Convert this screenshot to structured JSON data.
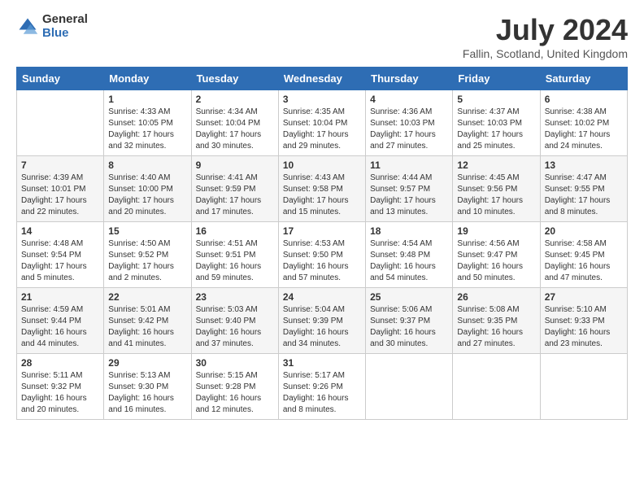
{
  "header": {
    "logo_general": "General",
    "logo_blue": "Blue",
    "month_title": "July 2024",
    "location": "Fallin, Scotland, United Kingdom"
  },
  "days_of_week": [
    "Sunday",
    "Monday",
    "Tuesday",
    "Wednesday",
    "Thursday",
    "Friday",
    "Saturday"
  ],
  "weeks": [
    [
      {
        "day": "",
        "info": ""
      },
      {
        "day": "1",
        "info": "Sunrise: 4:33 AM\nSunset: 10:05 PM\nDaylight: 17 hours and 32 minutes."
      },
      {
        "day": "2",
        "info": "Sunrise: 4:34 AM\nSunset: 10:04 PM\nDaylight: 17 hours and 30 minutes."
      },
      {
        "day": "3",
        "info": "Sunrise: 4:35 AM\nSunset: 10:04 PM\nDaylight: 17 hours and 29 minutes."
      },
      {
        "day": "4",
        "info": "Sunrise: 4:36 AM\nSunset: 10:03 PM\nDaylight: 17 hours and 27 minutes."
      },
      {
        "day": "5",
        "info": "Sunrise: 4:37 AM\nSunset: 10:03 PM\nDaylight: 17 hours and 25 minutes."
      },
      {
        "day": "6",
        "info": "Sunrise: 4:38 AM\nSunset: 10:02 PM\nDaylight: 17 hours and 24 minutes."
      }
    ],
    [
      {
        "day": "7",
        "info": "Sunrise: 4:39 AM\nSunset: 10:01 PM\nDaylight: 17 hours and 22 minutes."
      },
      {
        "day": "8",
        "info": "Sunrise: 4:40 AM\nSunset: 10:00 PM\nDaylight: 17 hours and 20 minutes."
      },
      {
        "day": "9",
        "info": "Sunrise: 4:41 AM\nSunset: 9:59 PM\nDaylight: 17 hours and 17 minutes."
      },
      {
        "day": "10",
        "info": "Sunrise: 4:43 AM\nSunset: 9:58 PM\nDaylight: 17 hours and 15 minutes."
      },
      {
        "day": "11",
        "info": "Sunrise: 4:44 AM\nSunset: 9:57 PM\nDaylight: 17 hours and 13 minutes."
      },
      {
        "day": "12",
        "info": "Sunrise: 4:45 AM\nSunset: 9:56 PM\nDaylight: 17 hours and 10 minutes."
      },
      {
        "day": "13",
        "info": "Sunrise: 4:47 AM\nSunset: 9:55 PM\nDaylight: 17 hours and 8 minutes."
      }
    ],
    [
      {
        "day": "14",
        "info": "Sunrise: 4:48 AM\nSunset: 9:54 PM\nDaylight: 17 hours and 5 minutes."
      },
      {
        "day": "15",
        "info": "Sunrise: 4:50 AM\nSunset: 9:52 PM\nDaylight: 17 hours and 2 minutes."
      },
      {
        "day": "16",
        "info": "Sunrise: 4:51 AM\nSunset: 9:51 PM\nDaylight: 16 hours and 59 minutes."
      },
      {
        "day": "17",
        "info": "Sunrise: 4:53 AM\nSunset: 9:50 PM\nDaylight: 16 hours and 57 minutes."
      },
      {
        "day": "18",
        "info": "Sunrise: 4:54 AM\nSunset: 9:48 PM\nDaylight: 16 hours and 54 minutes."
      },
      {
        "day": "19",
        "info": "Sunrise: 4:56 AM\nSunset: 9:47 PM\nDaylight: 16 hours and 50 minutes."
      },
      {
        "day": "20",
        "info": "Sunrise: 4:58 AM\nSunset: 9:45 PM\nDaylight: 16 hours and 47 minutes."
      }
    ],
    [
      {
        "day": "21",
        "info": "Sunrise: 4:59 AM\nSunset: 9:44 PM\nDaylight: 16 hours and 44 minutes."
      },
      {
        "day": "22",
        "info": "Sunrise: 5:01 AM\nSunset: 9:42 PM\nDaylight: 16 hours and 41 minutes."
      },
      {
        "day": "23",
        "info": "Sunrise: 5:03 AM\nSunset: 9:40 PM\nDaylight: 16 hours and 37 minutes."
      },
      {
        "day": "24",
        "info": "Sunrise: 5:04 AM\nSunset: 9:39 PM\nDaylight: 16 hours and 34 minutes."
      },
      {
        "day": "25",
        "info": "Sunrise: 5:06 AM\nSunset: 9:37 PM\nDaylight: 16 hours and 30 minutes."
      },
      {
        "day": "26",
        "info": "Sunrise: 5:08 AM\nSunset: 9:35 PM\nDaylight: 16 hours and 27 minutes."
      },
      {
        "day": "27",
        "info": "Sunrise: 5:10 AM\nSunset: 9:33 PM\nDaylight: 16 hours and 23 minutes."
      }
    ],
    [
      {
        "day": "28",
        "info": "Sunrise: 5:11 AM\nSunset: 9:32 PM\nDaylight: 16 hours and 20 minutes."
      },
      {
        "day": "29",
        "info": "Sunrise: 5:13 AM\nSunset: 9:30 PM\nDaylight: 16 hours and 16 minutes."
      },
      {
        "day": "30",
        "info": "Sunrise: 5:15 AM\nSunset: 9:28 PM\nDaylight: 16 hours and 12 minutes."
      },
      {
        "day": "31",
        "info": "Sunrise: 5:17 AM\nSunset: 9:26 PM\nDaylight: 16 hours and 8 minutes."
      },
      {
        "day": "",
        "info": ""
      },
      {
        "day": "",
        "info": ""
      },
      {
        "day": "",
        "info": ""
      }
    ]
  ]
}
